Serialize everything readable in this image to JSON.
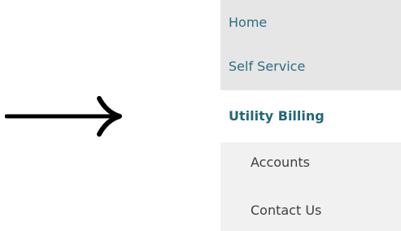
{
  "annotation": {
    "arrow_icon": "right-arrow-icon"
  },
  "nav": {
    "items": [
      {
        "label": "Home"
      },
      {
        "label": "Self Service"
      },
      {
        "label": "Utility Billing"
      },
      {
        "label": "Accounts"
      },
      {
        "label": "Contact Us"
      }
    ],
    "colors": {
      "link": "#2b6f82",
      "active_link": "#23677a",
      "sub_link": "#3f3f3f",
      "top_bg": "#e6e6e6",
      "sub_bg": "#f1f1f1"
    }
  }
}
